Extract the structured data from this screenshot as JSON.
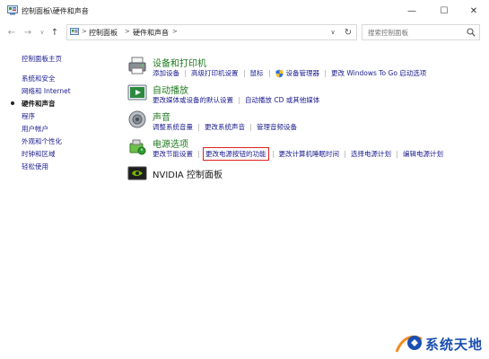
{
  "window": {
    "title": "控制面板\\硬件和声音",
    "minimize_glyph": "—",
    "maximize_glyph": "☐",
    "close_glyph": "✕"
  },
  "nav": {
    "back_glyph": "←",
    "forward_glyph": "→",
    "history_glyph": "∨",
    "up_glyph": "↑"
  },
  "address": {
    "crumbs": [
      "控制面板",
      "硬件和声音"
    ],
    "separator": ">",
    "dropdown_glyph": "∨",
    "refresh_glyph": "↻"
  },
  "search": {
    "placeholder": "搜索控制面板"
  },
  "sidebar": {
    "items": [
      {
        "label": "控制面板主页"
      },
      {
        "label": "系统和安全"
      },
      {
        "label": "网络和 Internet"
      },
      {
        "label": "硬件和声音",
        "current": true
      },
      {
        "label": "程序"
      },
      {
        "label": "用户帐户"
      },
      {
        "label": "外观和个性化"
      },
      {
        "label": "时钟和区域"
      },
      {
        "label": "轻松使用"
      }
    ]
  },
  "categories": {
    "devices": {
      "title": "设备和打印机",
      "icon": "printer-icon",
      "links": [
        "添加设备",
        "高级打印机设置",
        "鼠标",
        "设备管理器",
        "更改 Windows To Go 启动选项"
      ]
    },
    "autoplay": {
      "title": "自动播放",
      "icon": "autoplay-icon",
      "links": [
        "更改媒体或设备的默认设置",
        "自动播放 CD 或其他媒体"
      ]
    },
    "sound": {
      "title": "声音",
      "icon": "speaker-icon",
      "links": [
        "调整系统音量",
        "更改系统声音",
        "管理音频设备"
      ]
    },
    "power": {
      "title": "电源选项",
      "icon": "power-options-icon",
      "links": [
        "更改节能设置",
        "更改电源按钮的功能",
        "更改计算机睡眠时间",
        "选择电源计划",
        "编辑电源计划"
      ]
    },
    "nvidia": {
      "title": "NVIDIA 控制面板",
      "icon": "nvidia-icon"
    }
  },
  "watermark": {
    "text": "系统天地"
  },
  "colors": {
    "link": "#1b1b8f",
    "category_title": "#1f7a1f",
    "highlight_box": "#e02020",
    "watermark": "#1a4fb0"
  }
}
